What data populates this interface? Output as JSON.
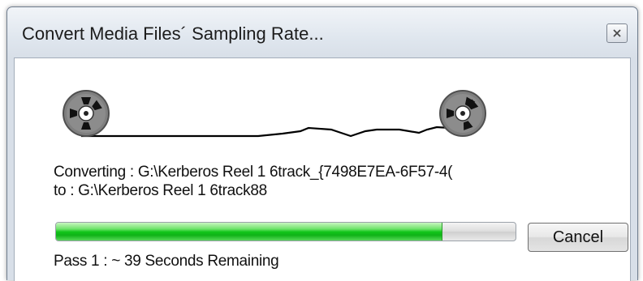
{
  "window": {
    "title": "Convert Media Files´ Sampling Rate..."
  },
  "status": {
    "converting": "Converting : G:\\Kerberos Reel 1 6track_{7498E7EA-6F57-4(",
    "to": "to : G:\\Kerberos Reel 1 6track88",
    "pass": "Pass 1 : ~ 39 Seconds Remaining"
  },
  "progress": {
    "fraction": 0.84,
    "fill_color": "#11c51a"
  },
  "buttons": {
    "cancel_label": "Cancel"
  },
  "icons": {
    "close": "close-icon",
    "reel": "tape-reel-icon"
  }
}
